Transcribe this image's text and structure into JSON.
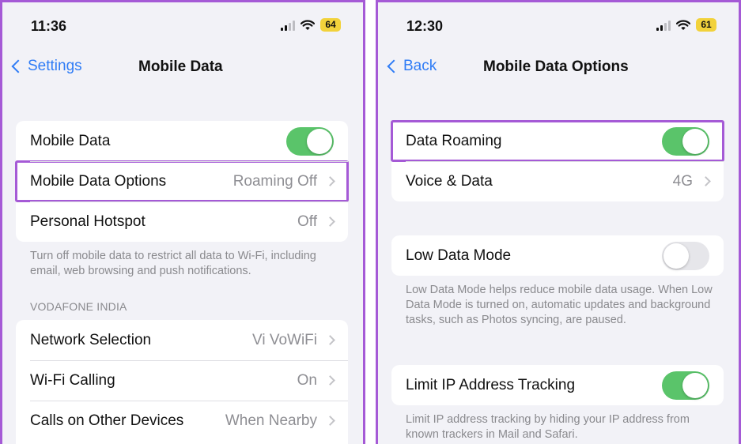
{
  "left": {
    "status": {
      "time": "11:36",
      "battery": "64"
    },
    "nav": {
      "back_label": "Settings",
      "title": "Mobile Data"
    },
    "group1": [
      {
        "label": "Mobile Data",
        "toggle": true
      },
      {
        "label": "Mobile Data Options",
        "value": "Roaming Off"
      },
      {
        "label": "Personal Hotspot",
        "value": "Off"
      }
    ],
    "footnote": "Turn off mobile data to restrict all data to Wi-Fi, including email, web browsing and push notifications.",
    "section_header": "VODAFONE INDIA",
    "group2": [
      {
        "label": "Network Selection",
        "value": "Vi VoWiFi"
      },
      {
        "label": "Wi-Fi Calling",
        "value": "On"
      },
      {
        "label": "Calls on Other Devices",
        "value": "When Nearby"
      }
    ]
  },
  "right": {
    "status": {
      "time": "12:30",
      "battery": "61"
    },
    "nav": {
      "back_label": "Back",
      "title": "Mobile Data Options"
    },
    "group1": [
      {
        "label": "Data Roaming",
        "toggle": true
      },
      {
        "label": "Voice & Data",
        "value": "4G"
      }
    ],
    "low_data": {
      "label": "Low Data Mode",
      "toggle": false
    },
    "low_data_footnote": "Low Data Mode helps reduce mobile data usage. When Low Data Mode is turned on, automatic updates and background tasks, such as Photos syncing, are paused.",
    "limit_ip": {
      "label": "Limit IP Address Tracking",
      "toggle": true
    },
    "limit_ip_footnote": "Limit IP address tracking by hiding your IP address from known trackers in Mail and Safari."
  },
  "colors": {
    "accent": "#2f7cf6",
    "toggle_on": "#5ac46a",
    "highlight": "#a55ad6"
  },
  "icons": [
    "signal-icon",
    "wifi-icon",
    "battery-icon",
    "chevron-left-icon",
    "chevron-right-icon"
  ]
}
